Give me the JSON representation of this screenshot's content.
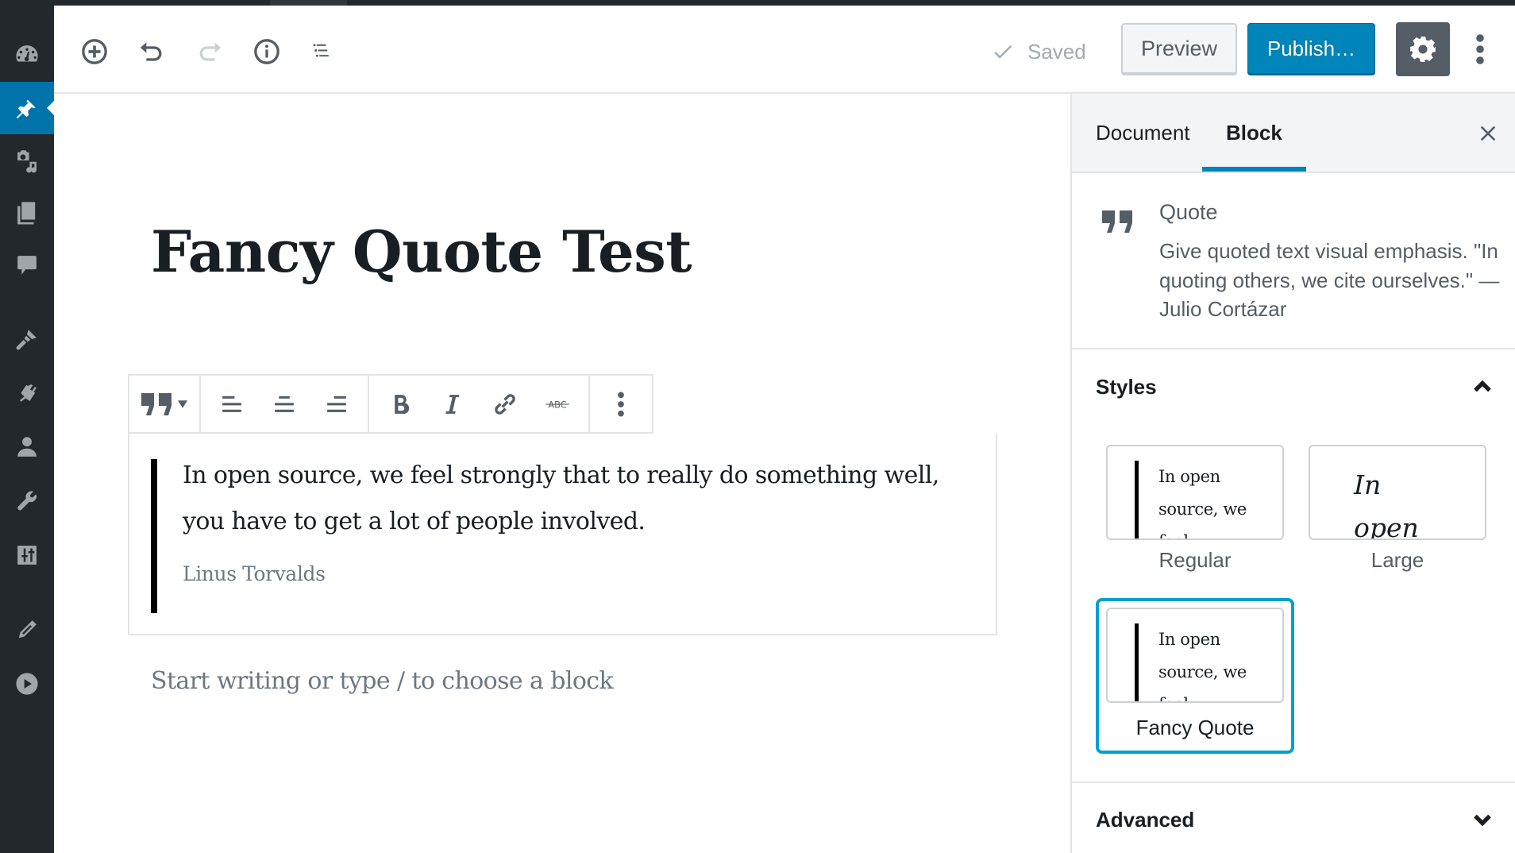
{
  "admin_menu": {
    "items": [
      {
        "name": "dashboard",
        "icon": "dashboard-icon",
        "active": false
      },
      {
        "name": "posts",
        "icon": "pin-icon",
        "active": true
      },
      {
        "name": "media",
        "icon": "media-icon",
        "active": false
      },
      {
        "name": "pages",
        "icon": "pages-icon",
        "active": false
      },
      {
        "name": "comments",
        "icon": "comment-icon",
        "active": false
      },
      {
        "name": "appearance",
        "icon": "paintbrush-icon",
        "active": false
      },
      {
        "name": "plugins",
        "icon": "plugin-icon",
        "active": false
      },
      {
        "name": "users",
        "icon": "user-icon",
        "active": false
      },
      {
        "name": "tools",
        "icon": "wrench-icon",
        "active": false
      },
      {
        "name": "settings",
        "icon": "sliders-icon",
        "active": false
      },
      {
        "name": "gutenberg",
        "icon": "pencil-icon",
        "active": false
      },
      {
        "name": "media-player",
        "icon": "play-icon",
        "active": false
      }
    ]
  },
  "header": {
    "icons": {
      "add_block": "plus-circle-icon",
      "undo": "undo-icon",
      "redo": "redo-icon",
      "info": "info-icon",
      "outline": "list-view-icon"
    },
    "saved_label": "Saved",
    "preview_label": "Preview",
    "publish_label": "Publish…",
    "settings_icon": "gear-icon",
    "more_icon": "vertical-ellipsis-icon"
  },
  "editor": {
    "post_title": "Fancy Quote Test",
    "block_toolbar": {
      "switcher_icon": "quote-icon",
      "align": [
        "align-left",
        "align-center",
        "align-right"
      ],
      "format": [
        "bold",
        "italic",
        "link",
        "strikethrough"
      ],
      "strikethrough_glyph": "ABC"
    },
    "quote": {
      "text": "In open source, we feel strongly that to really do something well, you have to get a lot of people involved.",
      "citation": "Linus Torvalds"
    },
    "appender_placeholder": "Start writing or type / to choose a block"
  },
  "sidebar": {
    "tabs": [
      {
        "label": "Document",
        "active": false
      },
      {
        "label": "Block",
        "active": true
      }
    ],
    "block_card": {
      "title": "Quote",
      "description": "Give quoted text visual emphasis. \"In quoting others, we cite ourselves.\" — Julio Cortázar"
    },
    "styles_panel": {
      "title": "Styles",
      "expanded": true,
      "preview_text": "In open source, we feel",
      "options": [
        {
          "label": "Regular",
          "selected": false
        },
        {
          "label": "Large",
          "selected": false
        },
        {
          "label": "Fancy Quote",
          "selected": true
        }
      ]
    },
    "advanced_panel": {
      "title": "Advanced",
      "expanded": false
    }
  },
  "colors": {
    "admin_bg": "#23282d",
    "accent": "#0085ba",
    "admin_active": "#0073aa",
    "selected_ring": "#00a0d2",
    "icon": "#555d66"
  }
}
